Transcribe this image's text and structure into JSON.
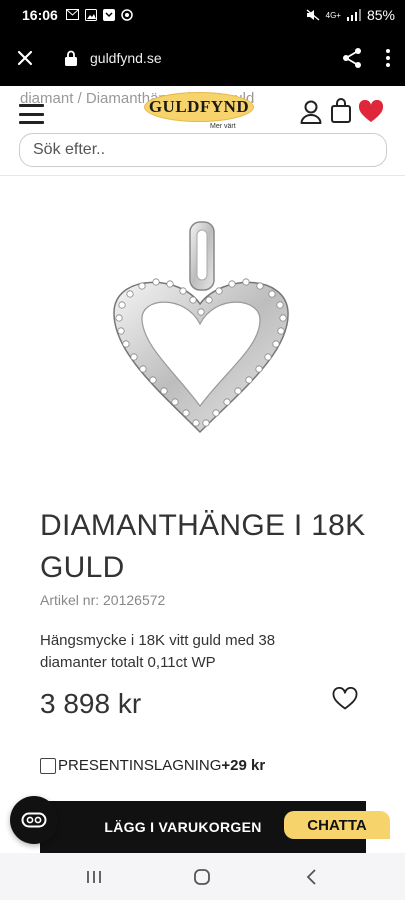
{
  "status_bar": {
    "time": "16:06",
    "battery": "85%",
    "network": "4G+"
  },
  "browser": {
    "url": "guldfynd.se"
  },
  "header": {
    "breadcrumb": "diamant / Diamanthänge i 18K guld",
    "logo_text": "GULDFYND",
    "logo_tagline": "Mer värt",
    "search_placeholder": "Sök efter.."
  },
  "product": {
    "title": "DIAMANTHÄNGE I 18K GULD",
    "article_no": "Artikel nr: 20126572",
    "description": "Hängsmycke i 18K vitt guld med 38 diamanter totalt 0,11ct WP",
    "price": "3 898 kr"
  },
  "gift_wrap": {
    "label": "PRESENTINSLAGNING",
    "price": "+29 kr"
  },
  "cta": {
    "add_to_cart": "LÄGG I VARUKORGEN",
    "chat": "CHATTA"
  },
  "colors": {
    "brand_gold": "#f6d36b",
    "favorite_red": "#e0263a",
    "button_black": "#111111"
  }
}
